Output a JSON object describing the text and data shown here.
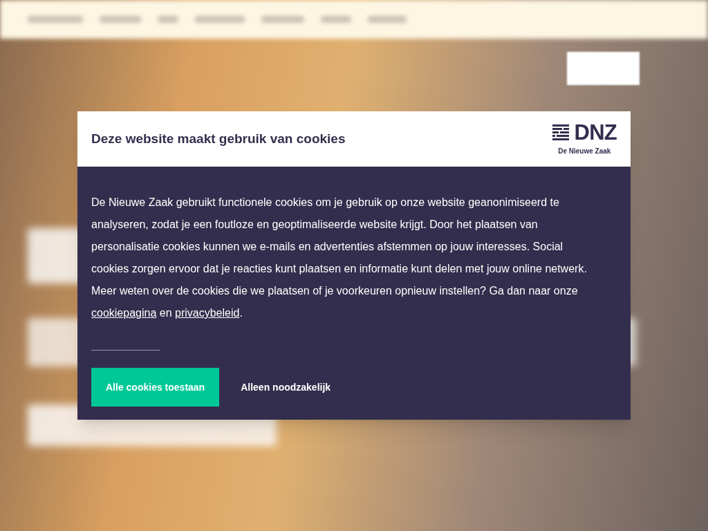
{
  "dialog": {
    "title": "Deze website maakt gebruik van cookies",
    "logo": {
      "wordmark": "DNZ",
      "tagline": "De Nieuwe Zaak"
    },
    "body": [
      {
        "kind": "text",
        "text": "De Nieuwe Zaak gebruikt functionele cookies om je gebruik op onze website geanonimiseerd te analyseren, zodat je een foutloze en geoptimaliseerde website krijgt. Door het plaatsen van personalisatie cookies kunnen we e-mails en advertenties afstemmen op jouw interesses. Social cookies zorgen ervoor dat je reacties kunt plaatsen en informatie kunt delen met jouw online netwerk. Meer weten over de cookies die we plaatsen of je voorkeuren opnieuw instellen? Ga dan naar onze "
      },
      {
        "kind": "link",
        "text": "cookiepagina"
      },
      {
        "kind": "text",
        "text": " en "
      },
      {
        "kind": "link",
        "text": "privacybeleid"
      },
      {
        "kind": "text",
        "text": "."
      }
    ],
    "buttons": [
      {
        "label": "Alle cookies toestaan",
        "kind": "primary"
      },
      {
        "label": "Alleen noodzakelijk",
        "kind": "plain"
      }
    ]
  }
}
